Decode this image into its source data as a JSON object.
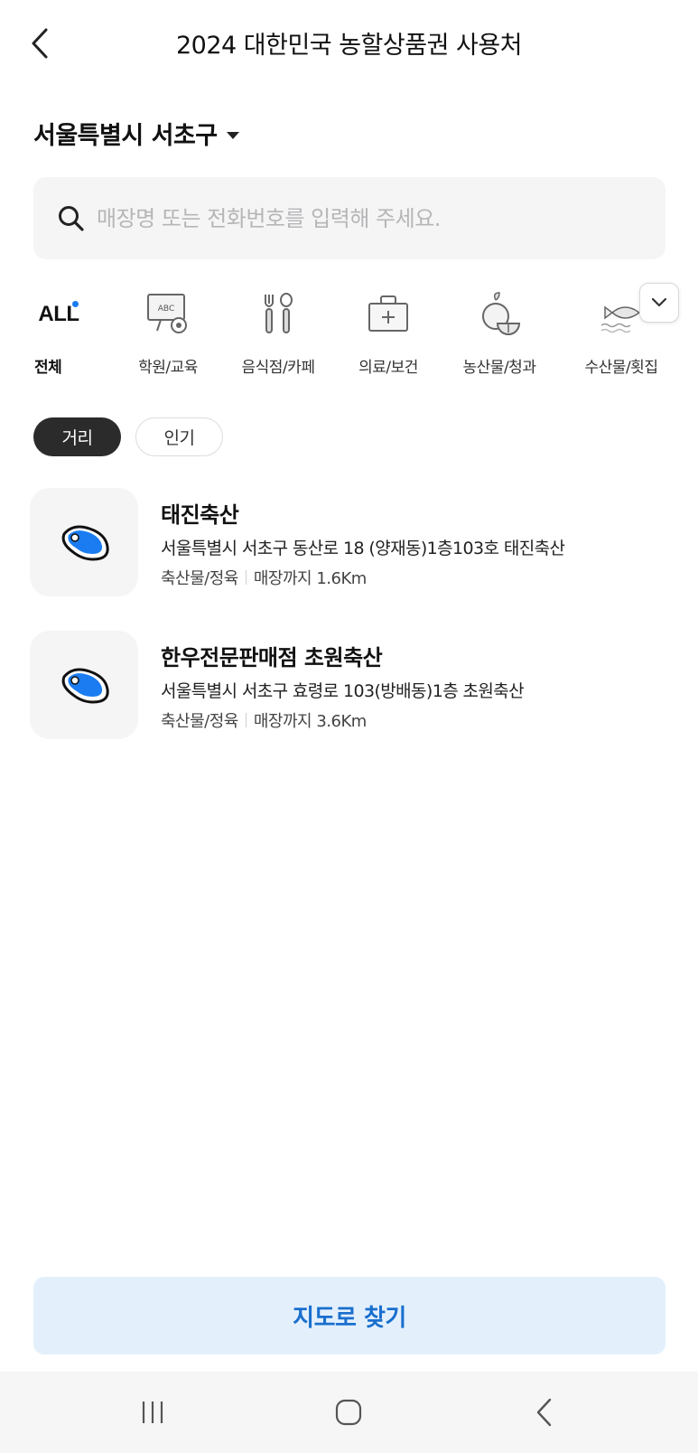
{
  "header": {
    "title": "2024 대한민국 농할상품권 사용처",
    "back_icon": "chevron-left-icon"
  },
  "region": {
    "label": "서울특별시 서초구",
    "dropdown_icon": "caret-down-icon"
  },
  "search": {
    "placeholder": "매장명 또는 전화번호를 입력해 주세요.",
    "value": "",
    "icon": "search-icon"
  },
  "categories": [
    {
      "label": "전체",
      "icon": "all-icon",
      "icon_text": "ALL",
      "active": true
    },
    {
      "label": "학원/교육",
      "icon": "abc-board-icon",
      "active": false
    },
    {
      "label": "음식점/카페",
      "icon": "fork-spoon-icon",
      "active": false
    },
    {
      "label": "의료/보건",
      "icon": "medical-kit-icon",
      "active": false
    },
    {
      "label": "농산물/청과",
      "icon": "fruit-icon",
      "active": false
    },
    {
      "label": "수산물/횟집",
      "icon": "fish-icon",
      "active": false
    }
  ],
  "category_expand_icon": "chevron-down-icon",
  "sort": {
    "options": [
      {
        "label": "거리",
        "active": true
      },
      {
        "label": "인기",
        "active": false
      }
    ]
  },
  "stores": [
    {
      "name": "태진축산",
      "address": "서울특별시 서초구 동산로 18 (양재동)1층103호 태진축산",
      "category": "축산물/정육",
      "distance": "매장까지 1.6Km",
      "icon": "meat-icon"
    },
    {
      "name": "한우전문판매점 초원축산",
      "address": "서울특별시 서초구 효령로 103(방배동)1층 초원축산",
      "category": "축산물/정육",
      "distance": "매장까지 3.6Km",
      "icon": "meat-icon"
    }
  ],
  "map_button": {
    "label": "지도로 찾기"
  },
  "colors": {
    "accent": "#1a7cf0",
    "map_button_bg": "#e3f0fc",
    "map_button_text": "#1a6fce",
    "sort_active_bg": "#2b2b2b"
  },
  "system_nav": {
    "items": [
      "recent-apps-icon",
      "home-icon",
      "back-icon"
    ]
  }
}
